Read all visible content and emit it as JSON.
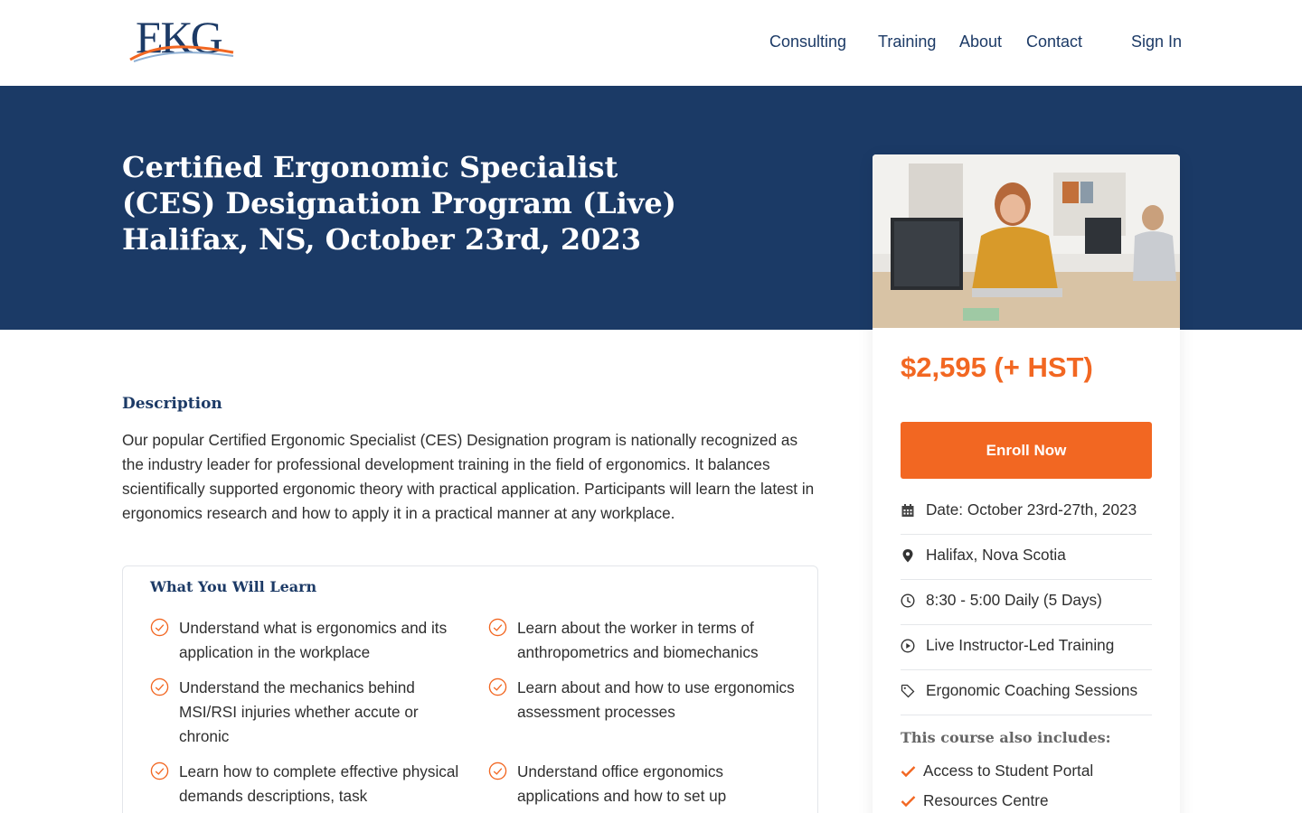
{
  "brand": {
    "logo_text": "EKG"
  },
  "nav": {
    "consulting": "Consulting",
    "training": "Training",
    "about": "About",
    "contact": "Contact",
    "sign_in": "Sign In"
  },
  "hero": {
    "title": "Certified Ergonomic Specialist (CES) Designation Program (Live) Halifax, NS, October 23rd, 2023"
  },
  "description": {
    "heading": "Description",
    "text": "Our popular Certified Ergonomic Specialist (CES) Designation program is nationally recognized as the industry leader for professional development training in the field of ergonomics. It balances scientifically supported ergonomic theory with practical application. Participants will learn the latest in ergonomics research and how to apply it in a practical manner at any workplace."
  },
  "learn": {
    "heading": "What You Will Learn",
    "items": [
      "Understand what is ergonomics and its application in the workplace",
      "Learn about the worker in terms of anthropometrics and biomechanics",
      "Understand the mechanics behind MSI/RSI injuries whether accute or chronic",
      "Learn about and how to use ergonomics assessment processes",
      "Learn how to complete effective physical demands descriptions, task",
      "Understand office ergonomics applications and how to set up"
    ]
  },
  "course": {
    "price": "$2,595 (+ HST)",
    "enroll_label": "Enroll Now",
    "details": [
      {
        "icon": "calendar-icon",
        "label": "Date: October 23rd-27th, 2023"
      },
      {
        "icon": "map-pin-icon",
        "label": "Halifax, Nova Scotia"
      },
      {
        "icon": "clock-icon",
        "label": "8:30 - 5:00 Daily (5 Days)"
      },
      {
        "icon": "play-circle-icon",
        "label": "Live Instructor-Led Training"
      },
      {
        "icon": "tag-icon",
        "label": "Ergonomic Coaching Sessions"
      }
    ],
    "includes_heading": "This course also includes:",
    "includes": [
      "Access to Student Portal",
      "Resources Centre"
    ]
  },
  "colors": {
    "navy": "#1b3a66",
    "orange": "#f26722"
  }
}
